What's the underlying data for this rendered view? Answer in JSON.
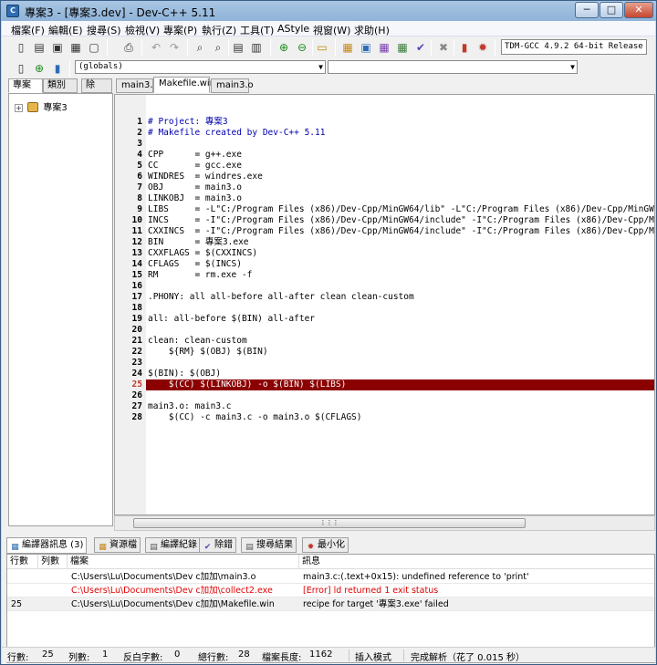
{
  "window": {
    "title": "專案3 - [專案3.dev] - Dev-C++ 5.11",
    "app_icon_label": "C",
    "minimize": "─",
    "maximize": "□",
    "close": "✕"
  },
  "menu": [
    "檔案(F)",
    "編輯(E)",
    "搜尋(S)",
    "檢視(V)",
    "專案(P)",
    "執行(Z)",
    "工具(T)",
    "AStyle",
    "視窗(W)",
    "求助(H)"
  ],
  "toolbar": {
    "compiler": "TDM-GCC 4.9.2 64-bit Release",
    "scope_combo": "(globals)",
    "member_combo": ""
  },
  "left_tabs": [
    "專案",
    "類別",
    "除"
  ],
  "tree": {
    "project_name": "專案3",
    "expander": "+"
  },
  "file_tabs": [
    "main3.c",
    "Makefile.win",
    "main3.o"
  ],
  "active_file_tab": 1,
  "editor": {
    "error_line_number": 25,
    "lines": [
      {
        "n": "1",
        "text": "# Project: 專案3"
      },
      {
        "n": "2",
        "text": "# Makefile created by Dev-C++ 5.11"
      },
      {
        "n": "3",
        "text": ""
      },
      {
        "n": "4",
        "text": "CPP      = g++.exe"
      },
      {
        "n": "5",
        "text": "CC       = gcc.exe"
      },
      {
        "n": "6",
        "text": "WINDRES  = windres.exe"
      },
      {
        "n": "7",
        "text": "OBJ      = main3.o"
      },
      {
        "n": "8",
        "text": "LINKOBJ  = main3.o"
      },
      {
        "n": "9",
        "text": "LIBS     = -L\"C:/Program Files (x86)/Dev-Cpp/MinGW64/lib\" -L\"C:/Program Files (x86)/Dev-Cpp/MinGW64/"
      },
      {
        "n": "10",
        "text": "INCS     = -I\"C:/Program Files (x86)/Dev-Cpp/MinGW64/include\" -I\"C:/Program Files (x86)/Dev-Cpp/MinGW"
      },
      {
        "n": "11",
        "text": "CXXINCS  = -I\"C:/Program Files (x86)/Dev-Cpp/MinGW64/include\" -I\"C:/Program Files (x86)/Dev-Cpp/MinG"
      },
      {
        "n": "12",
        "text": "BIN      = 專案3.exe"
      },
      {
        "n": "13",
        "text": "CXXFLAGS = $(CXXINCS)"
      },
      {
        "n": "14",
        "text": "CFLAGS   = $(INCS)"
      },
      {
        "n": "15",
        "text": "RM       = rm.exe -f"
      },
      {
        "n": "16",
        "text": ""
      },
      {
        "n": "17",
        "text": ".PHONY: all all-before all-after clean clean-custom"
      },
      {
        "n": "18",
        "text": ""
      },
      {
        "n": "19",
        "text": "all: all-before $(BIN) all-after"
      },
      {
        "n": "20",
        "text": ""
      },
      {
        "n": "21",
        "text": "clean: clean-custom"
      },
      {
        "n": "22",
        "text": "    ${RM} $(OBJ) $(BIN)"
      },
      {
        "n": "23",
        "text": ""
      },
      {
        "n": "24",
        "text": "$(BIN): $(OBJ)"
      },
      {
        "n": "25",
        "text": "    $(CC) $(LINKOBJ) -o $(BIN) $(LIBS)"
      },
      {
        "n": "26",
        "text": ""
      },
      {
        "n": "27",
        "text": "main3.o: main3.c"
      },
      {
        "n": "28",
        "text": "    $(CC) -c main3.c -o main3.o $(CFLAGS)"
      }
    ]
  },
  "bottom_tabs": [
    {
      "label": "編譯器訊息 (3)",
      "icon": "compiler-icon"
    },
    {
      "label": "資源檔",
      "icon": "resources-icon"
    },
    {
      "label": "編譯紀錄",
      "icon": "log-icon"
    },
    {
      "label": "除錯",
      "icon": "debug-icon"
    },
    {
      "label": "搜尋結果",
      "icon": "search-results-icon"
    },
    {
      "label": "最小化",
      "icon": "minimize-icon"
    }
  ],
  "messages": {
    "headers": [
      "行數",
      "列數",
      "檔案",
      "訊息"
    ],
    "rows": [
      {
        "line": "",
        "col": "",
        "file": "C:\\Users\\Lu\\Documents\\Dev c加加\\main3.o",
        "msg": "main3.c:(.text+0x15): undefined reference to 'print'",
        "error": false
      },
      {
        "line": "",
        "col": "",
        "file": "C:\\Users\\Lu\\Documents\\Dev c加加\\collect2.exe",
        "msg": "[Error] ld returned 1 exit status",
        "error": true
      },
      {
        "line": "25",
        "col": "",
        "file": "C:\\Users\\Lu\\Documents\\Dev c加加\\Makefile.win",
        "msg": "recipe for target '專案3.exe' failed",
        "error": false
      }
    ]
  },
  "status": {
    "line_label": "行數:",
    "line": "25",
    "col_label": "列數:",
    "col": "1",
    "sel_label": "反白字數:",
    "sel": "0",
    "total_label": "總行數:",
    "total": "28",
    "len_label": "檔案長度:",
    "len": "1162",
    "mode": "插入模式",
    "parse": "完成解析（花了 0.015 秒）"
  }
}
